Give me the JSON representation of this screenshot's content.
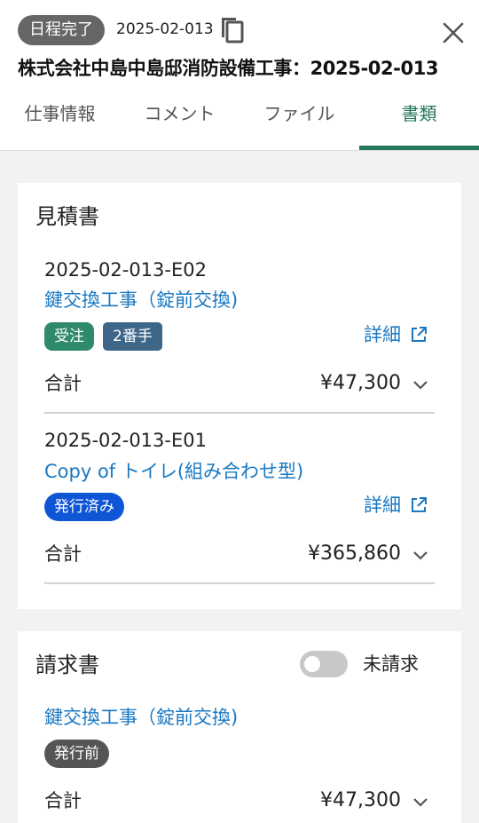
{
  "header": {
    "status": "日程完了",
    "job_id": "2025-02-013",
    "title": "株式会社中島中島邸消防設備工事：2025-02-013"
  },
  "tabs": [
    {
      "label": "仕事情報",
      "active": false
    },
    {
      "label": "コメント",
      "active": false
    },
    {
      "label": "ファイル",
      "active": false
    },
    {
      "label": "書類",
      "active": true
    }
  ],
  "estimates": {
    "heading": "見積書",
    "items": [
      {
        "number": "2025-02-013-E02",
        "name": "鍵交換工事（錠前交換)",
        "badges": [
          "受注",
          "2番手"
        ],
        "detail_label": "詳細",
        "total_label": "合計",
        "total": "¥47,300"
      },
      {
        "number": "2025-02-013-E01",
        "name": "Copy of トイレ(組み合わせ型)",
        "badges": [
          "発行済み"
        ],
        "detail_label": "詳細",
        "total_label": "合計",
        "total": "¥365,860"
      }
    ]
  },
  "invoices": {
    "heading": "請求書",
    "toggle_label": "未請求",
    "toggle_on": false,
    "items": [
      {
        "name": "鍵交換工事（錠前交換)",
        "badges": [
          "発行前"
        ],
        "total_label": "合計",
        "total": "¥47,300"
      }
    ]
  },
  "colors": {
    "accent_green": "#23775a",
    "link_blue": "#1a78c2",
    "badge_blue": "#0f56d7"
  },
  "icons": [
    "copy-icon",
    "close-icon",
    "external-link-icon",
    "chevron-down-icon"
  ]
}
